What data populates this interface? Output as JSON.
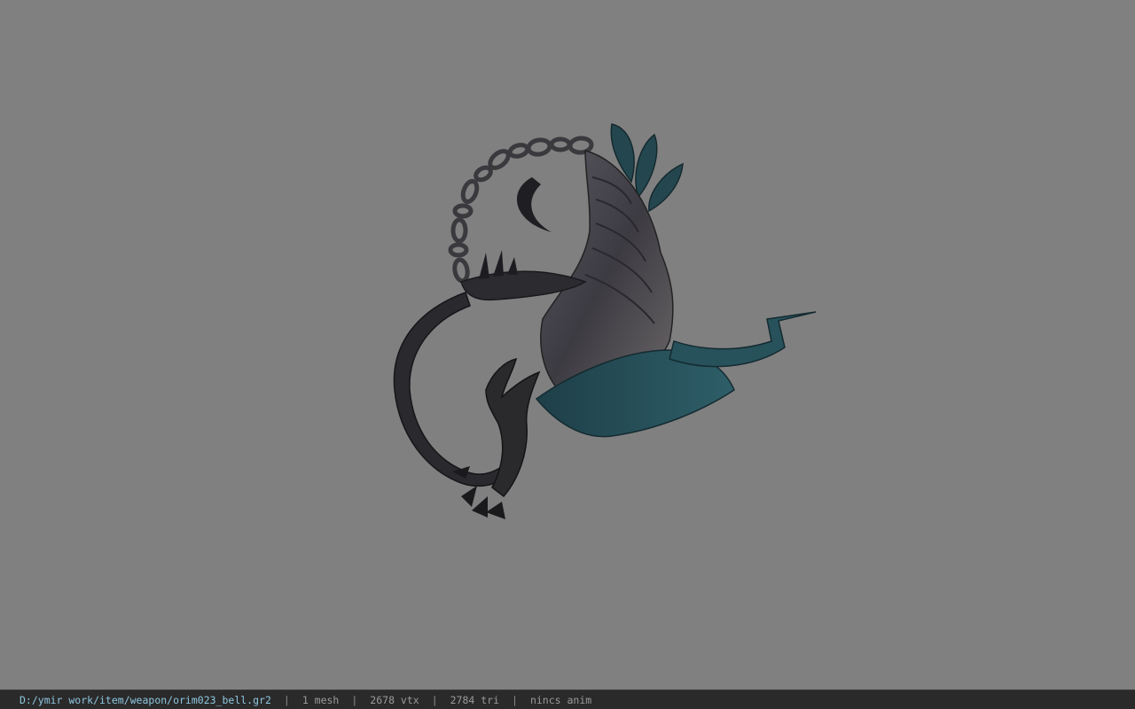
{
  "viewer": {
    "background_color": "#808080",
    "model_subject": "weapon bell model (chain, claw, teal blades)"
  },
  "status_bar": {
    "file_path": "D:/ymir work/item/weapon/orim023_bell.gr2",
    "mesh_count": "1 mesh",
    "vertex_count": "2678 vtx",
    "triangle_count": "2784 tri",
    "animation": "nincs anim",
    "separator": "|",
    "path_color": "#8ec6df"
  }
}
